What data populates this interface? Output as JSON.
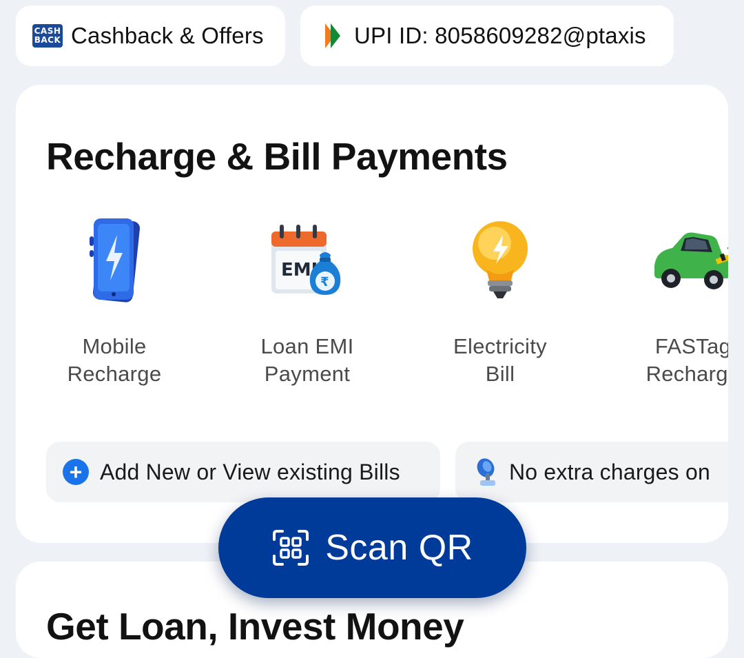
{
  "top_chips": {
    "cashback": {
      "logo_line1": "CASH",
      "logo_line2": "BACK",
      "label": "Cashback & Offers"
    },
    "upi": {
      "label": "UPI ID: 8058609282@ptaxis"
    }
  },
  "bills_section": {
    "title": "Recharge & Bill Payments",
    "services": [
      {
        "icon": "mobile-phone-bolt-icon",
        "line1": "Mobile",
        "line2": "Recharge"
      },
      {
        "icon": "calendar-emi-money-bag-icon",
        "emi_text": "EMI",
        "line1": "Loan EMI",
        "line2": "Payment"
      },
      {
        "icon": "light-bulb-bolt-icon",
        "line1": "Electricity",
        "line2": "Bill"
      },
      {
        "icon": "car-toll-gate-icon",
        "line1": "FASTag",
        "line2": "Recharge"
      }
    ],
    "add_bills_label": "Add New or View existing Bills",
    "no_extra_label": "No extra charges on"
  },
  "scan_button": {
    "label": "Scan QR"
  },
  "next_section": {
    "title": "Get Loan, Invest Money"
  },
  "colors": {
    "background": "#eef2f7",
    "scan_button": "#003b99",
    "plus_icon": "#1a73e8",
    "cashback_logo": "#1b4a9b"
  }
}
